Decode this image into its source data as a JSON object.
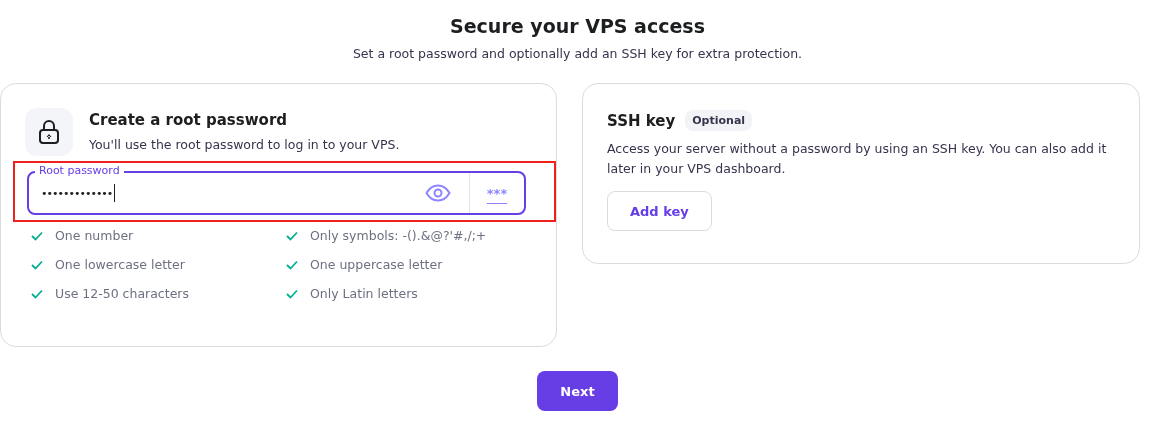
{
  "header": {
    "title": "Secure your VPS access",
    "subtitle": "Set a root password and optionally add an SSH key for extra protection."
  },
  "password_card": {
    "title": "Create a root password",
    "description": "You'll use the root password to log in to your VPS.",
    "field": {
      "label": "Root password",
      "value": "•••••••••••••",
      "focused": true,
      "highlighted": true,
      "generate_label": "***"
    },
    "requirements": [
      {
        "text": "One number",
        "met": true
      },
      {
        "text": "Only symbols: -().&@?'#,/;+",
        "met": true
      },
      {
        "text": "One lowercase letter",
        "met": true
      },
      {
        "text": "One uppercase letter",
        "met": true
      },
      {
        "text": "Use 12-50 characters",
        "met": true
      },
      {
        "text": "Only Latin letters",
        "met": true
      }
    ]
  },
  "ssh_card": {
    "title": "SSH key",
    "badge": "Optional",
    "description": "Access your server without a password by using an SSH key. You can also add it later in your VPS dashboard.",
    "button": "Add key"
  },
  "next_button": "Next"
}
